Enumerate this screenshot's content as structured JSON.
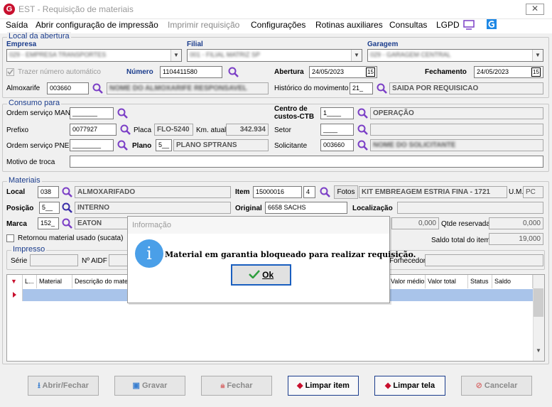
{
  "app": {
    "logo": "G",
    "title": "EST - Requisição de materiais",
    "close": "✕"
  },
  "menu": {
    "saida": "Saída",
    "abrir_config": "Abrir configuração de impressão",
    "imprimir": "Imprimir requisição",
    "configuracoes": "Configurações",
    "rotinas": "Rotinas auxiliares",
    "consultas": "Consultas",
    "lgpd": "LGPD"
  },
  "local_abertura": {
    "title": "Local da abertura",
    "empresa_label": "Empresa",
    "empresa_value": "029 - EMPRESA TRANSPORTES",
    "filial_label": "Filial",
    "filial_value": "001 - FILIAL MATRIZ SP",
    "garagem_label": "Garagem",
    "garagem_value": "029 - GARAGEM CENTRAL",
    "trazer_numero": "Trazer número automático",
    "numero_label": "Número",
    "numero_value": "1104411580",
    "abertura_label": "Abertura",
    "abertura_value": "24/05/2023",
    "fechamento_label": "Fechamento",
    "fechamento_value": "24/05/2023",
    "almoxarife_label": "Almoxarife",
    "almoxarife_value": "003660",
    "almoxarife_nome": "NOME DO ALMOXARIFE RESPONSAVEL",
    "historico_label": "Histórico do movimento",
    "historico_code": "21_",
    "historico_desc": "SAIDA POR REQUISICAO",
    "cal_glyph": "15"
  },
  "consumo": {
    "title": "Consumo para",
    "os_man_label": "Ordem serviço MAN",
    "os_man_value": "_______",
    "centro_label_1": "Centro de",
    "centro_label_2": "custos-CTB",
    "centro_code": "1____",
    "centro_desc": "OPERAÇÃO",
    "prefixo_label": "Prefixo",
    "prefixo_value": "0077927",
    "placa_label": "Placa",
    "placa_value": "FLO-5240",
    "km_label": "Km. atual",
    "km_value": "342.934",
    "setor_label": "Setor",
    "setor_value": "____",
    "os_pne_label": "Ordem serviço PNE",
    "os_pne_value": "________",
    "plano_label": "Plano",
    "plano_code": "5__",
    "plano_desc": "PLANO SPTRANS",
    "solicitante_label": "Solicitante",
    "solicitante_value": "003660",
    "solicitante_nome": "NOME DO SOLICITANTE",
    "motivo_label": "Motivo de troca",
    "motivo_value": ""
  },
  "materiais": {
    "title": "Materiais",
    "local_label": "Local",
    "local_code": "038",
    "local_desc": "ALMOXARIFADO",
    "item_label": "Item",
    "item_code": "15000016",
    "item_seq": "4",
    "fotos_label": "Fotos",
    "item_desc": "KIT EMBREAGEM ESTRIA FINA - 1721",
    "um_label": "U.M.",
    "um_value": "PC",
    "posicao_label": "Posição",
    "posicao_code": "5__",
    "posicao_desc": "INTERNO",
    "original_label": "Original",
    "original_value": "6658 SACHS",
    "localizacao_label": "Localização",
    "localizacao_value": "",
    "marca_label": "Marca",
    "marca_code": "152_",
    "marca_desc": "EATON",
    "qtde_reservada_label": "Qtde reservada",
    "qtde_reservada_value": "0,000",
    "field_value": "0,000",
    "retornou_label": "Retornou material usado (sucata)",
    "saldo_label": "Saldo total do item",
    "saldo_value": "19,000",
    "impresso_title": "Impresso",
    "serie_label": "Série",
    "aidf_label": "Nº AIDF",
    "fornecedor_label": "Fornecedor"
  },
  "grid": {
    "columns": [
      "L...",
      "Material",
      "Descrição do material",
      "Valor médio",
      "Valor total",
      "Status",
      "Saldo"
    ]
  },
  "buttons": {
    "abrir_fechar": "Abrir/Fechar",
    "gravar": "Gravar",
    "fechar": "Fechar",
    "limpar_item": "Limpar item",
    "limpar_tela": "Limpar tela",
    "cancelar": "Cancelar"
  },
  "modal": {
    "title": "Informação",
    "message": "Material em garantia bloqueado para realizar requisição.",
    "ok": "Ok",
    "info_glyph": "i"
  },
  "colors": {
    "accent": "#1a3c8c",
    "brand": "#c8102e",
    "info": "#4a9fe8",
    "magnifier": "#7b3fc6"
  }
}
